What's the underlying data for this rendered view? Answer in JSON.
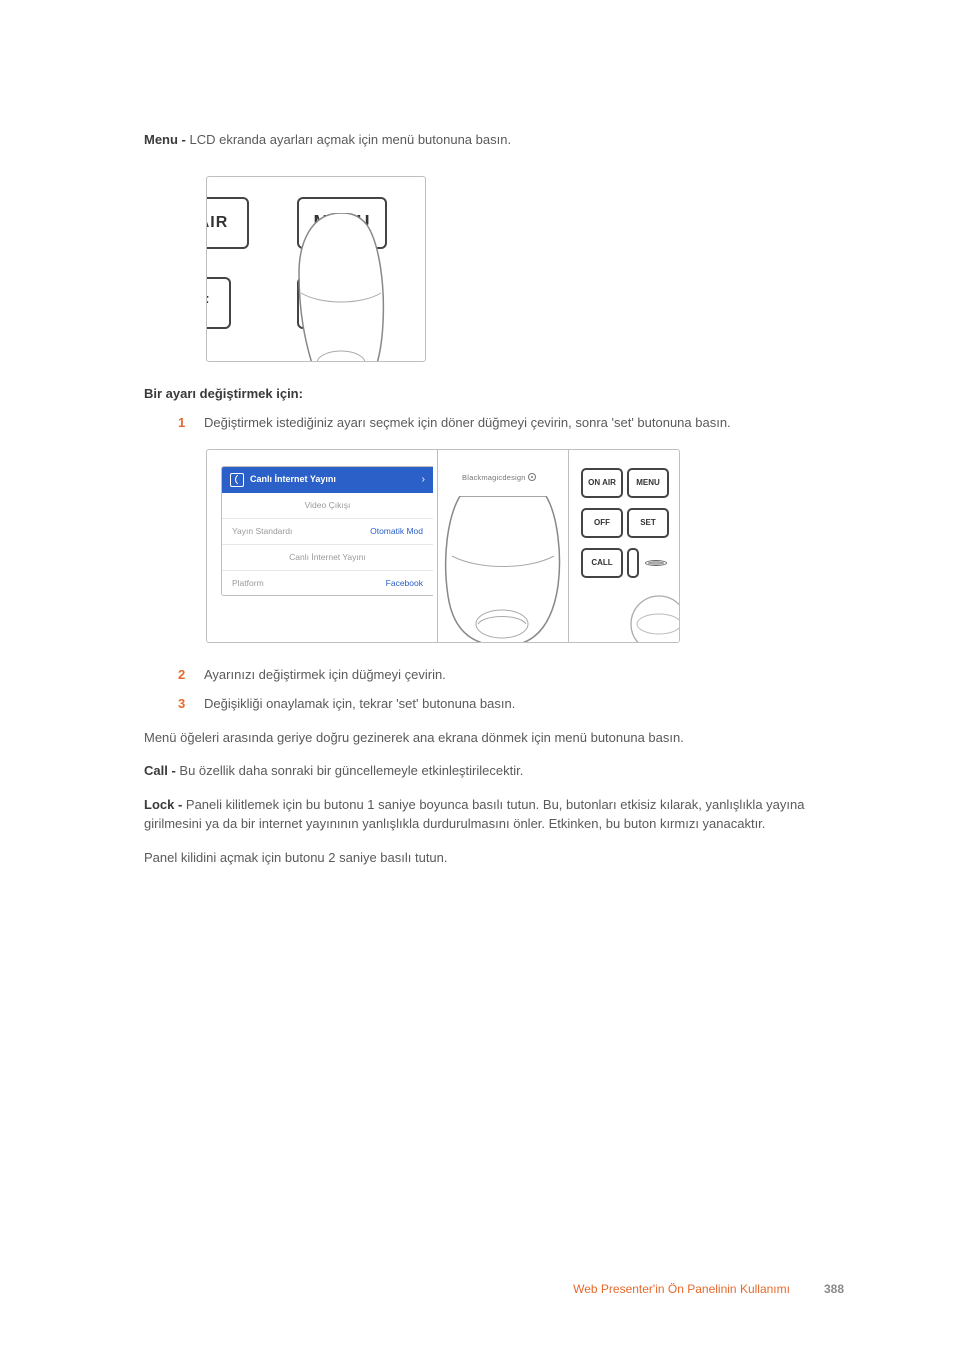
{
  "intro_menu": {
    "lead": "Menu - ",
    "text": "LCD ekranda ayarları açmak için menü butonuna basın."
  },
  "fig1": {
    "air": "AIR",
    "menu": "MENU",
    "f": "F"
  },
  "heading_change": "Bir ayarı değiştirmek için:",
  "steps": {
    "s1_num": "1",
    "s1_text": "Değiştirmek istediğiniz ayarı seçmek için döner düğmeyi çevirin, sonra 'set' butonuna basın.",
    "s2_num": "2",
    "s2_text": "Ayarınızı değiştirmek için düğmeyi çevirin.",
    "s3_num": "3",
    "s3_text": "Değişikliği onaylamak için, tekrar 'set' butonuna basın."
  },
  "fig2": {
    "lcd": {
      "bar_title": "Canlı İnternet Yayını",
      "row1": "Video Çıkışı",
      "row2_left": "Yayın Standardı",
      "row2_right": "Otomatik Mod",
      "row3": "Canlı İnternet Yayını",
      "row4_left": "Platform",
      "row4_right": "Facebook"
    },
    "brand": "Blackmagicdesign",
    "buttons": {
      "onair": "ON AIR",
      "menu": "MENU",
      "off": "OFF",
      "set": "SET",
      "call": "CALL"
    }
  },
  "after_steps": "Menü öğeleri arasında geriye doğru gezinerek ana ekrana dönmek için menü butonuna basın.",
  "call_para": {
    "lead": "Call - ",
    "text": "Bu özellik daha sonraki bir güncellemeyle etkinleştirilecektir."
  },
  "lock_para": {
    "lead": "Lock - ",
    "text": "Paneli kilitlemek için bu butonu 1 saniye boyunca basılı tutun. Bu, butonları etkisiz kılarak, yanlışlıkla yayına girilmesini ya da bir internet yayınının yanlışlıkla durdurulmasını önler. Etkinken, bu buton kırmızı yanacaktır."
  },
  "unlock_para": "Panel kilidini açmak için butonu 2 saniye basılı tutun.",
  "footer": {
    "title": "Web Presenter'in Ön Panelinin Kullanımı",
    "page": "388"
  }
}
